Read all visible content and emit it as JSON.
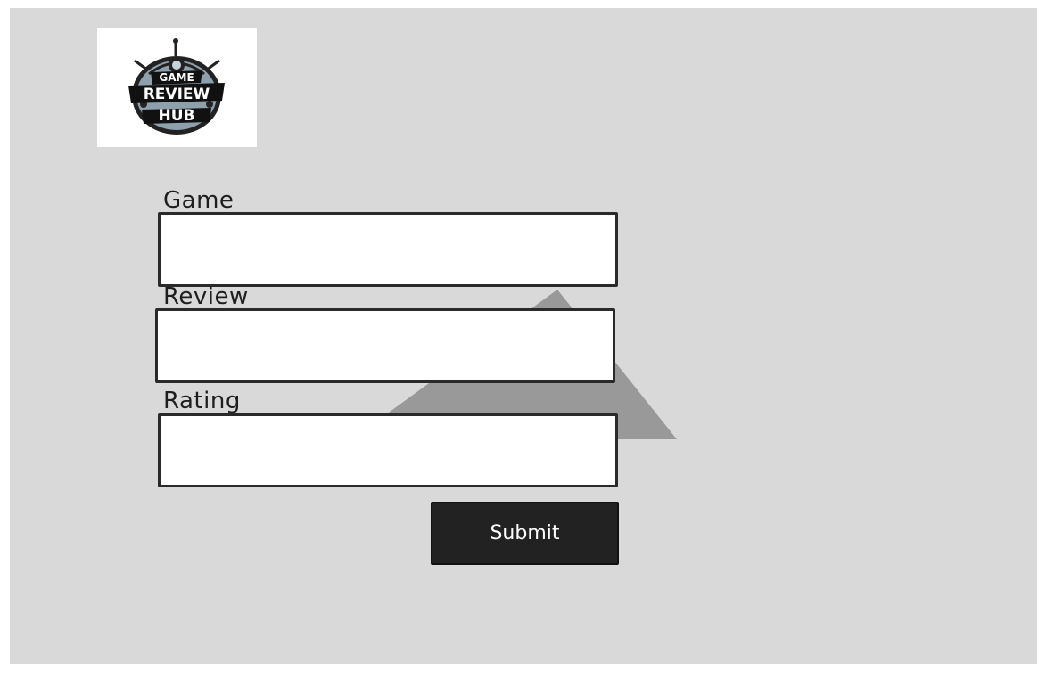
{
  "logo": {
    "line1": "GAME",
    "line2": "REVIEW",
    "line3": "HUB"
  },
  "form": {
    "game_label": "Game",
    "game_value": "",
    "review_label": "Review",
    "review_value": "",
    "rating_label": "Rating",
    "rating_value": "",
    "submit_label": "Submit"
  },
  "colors": {
    "background": "#d9d9d9",
    "triangle": "#9a9a9a",
    "button": "#222222",
    "button_text": "#ffffff"
  }
}
